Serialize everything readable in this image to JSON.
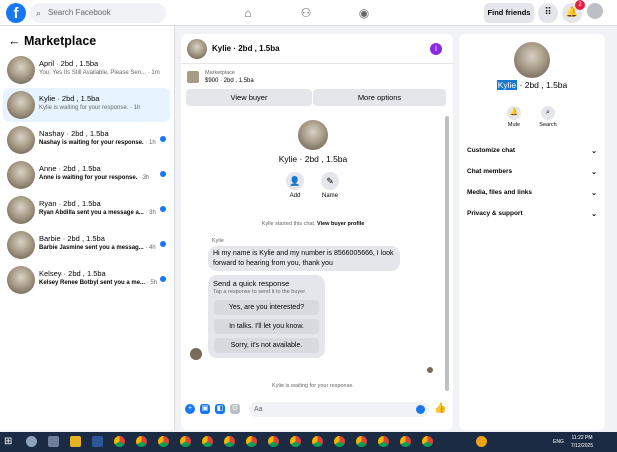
{
  "topbar": {
    "logo": "f",
    "search_placeholder": "Search Facebook",
    "find_friends": "Find friends",
    "notification_count": "2"
  },
  "left": {
    "title": "Marketplace",
    "chats": [
      {
        "name": "April · 2bd , 1.5ba",
        "preview": "You: Yes Its Still Available, Please Sen...",
        "time": " · 1m",
        "unread": false
      },
      {
        "name": "Kylie · 2bd , 1.5ba",
        "preview": "Kylie is waiting for your response.",
        "time": " · 1h",
        "unread": false
      },
      {
        "name": "Nashay · 2bd , 1.5ba",
        "preview": "Nashay is waiting for your response.",
        "time": " · 1h",
        "unread": true
      },
      {
        "name": "Anne · 2bd , 1.5ba",
        "preview": "Anne is waiting for your response.",
        "time": " · 3h",
        "unread": true
      },
      {
        "name": "Ryan · 2bd , 1.5ba",
        "preview": "Ryan Abdilla sent you a message a...",
        "time": " · 3h",
        "unread": true
      },
      {
        "name": "Barbie · 2bd , 1.5ba",
        "preview": "Barbie Jasmine sent you a messag...",
        "time": " · 4h",
        "unread": true
      },
      {
        "name": "Kelsey · 2bd , 1.5ba",
        "preview": "Kelsey Renee Botbyl sent you a me...",
        "time": " · 5h",
        "unread": true
      }
    ]
  },
  "conversation": {
    "title": "Kylie · 2bd , 1.5ba",
    "listing_label": "Marketplace",
    "listing_price": "$900 · 2bd , 1.5ba",
    "view_buyer": "View buyer",
    "more_options": "More options",
    "profile_name": "Kylie · 2bd , 1.5ba",
    "add_label": "Add",
    "name_label": "Name",
    "started_prefix": "Kylie started this chat. ",
    "started_link": "View buyer profile",
    "sender": "Kylie",
    "message": "Hi my name is Kylie and my number is 8566005666, I look forward to hearing from you, thank you",
    "quick_title": "Send a quick response",
    "quick_sub": "Tap a response to send it to the buyer.",
    "quick_replies": [
      "Yes, are you interested?",
      "In talks. I'll let you know.",
      "Sorry, it's not available."
    ],
    "waiting": "Kylie is waiting for your response.",
    "composer_placeholder": "Aa"
  },
  "right": {
    "name_highlight": "Kylie",
    "name_rest": " · 2bd , 1.5ba",
    "mute": "Mute",
    "search": "Search",
    "sections": [
      "Customize chat",
      "Chat members",
      "Media, files and links",
      "Privacy & support"
    ]
  },
  "taskbar": {
    "lang": "ENG",
    "time": "11:22 PM",
    "date": "7/12/2025"
  }
}
